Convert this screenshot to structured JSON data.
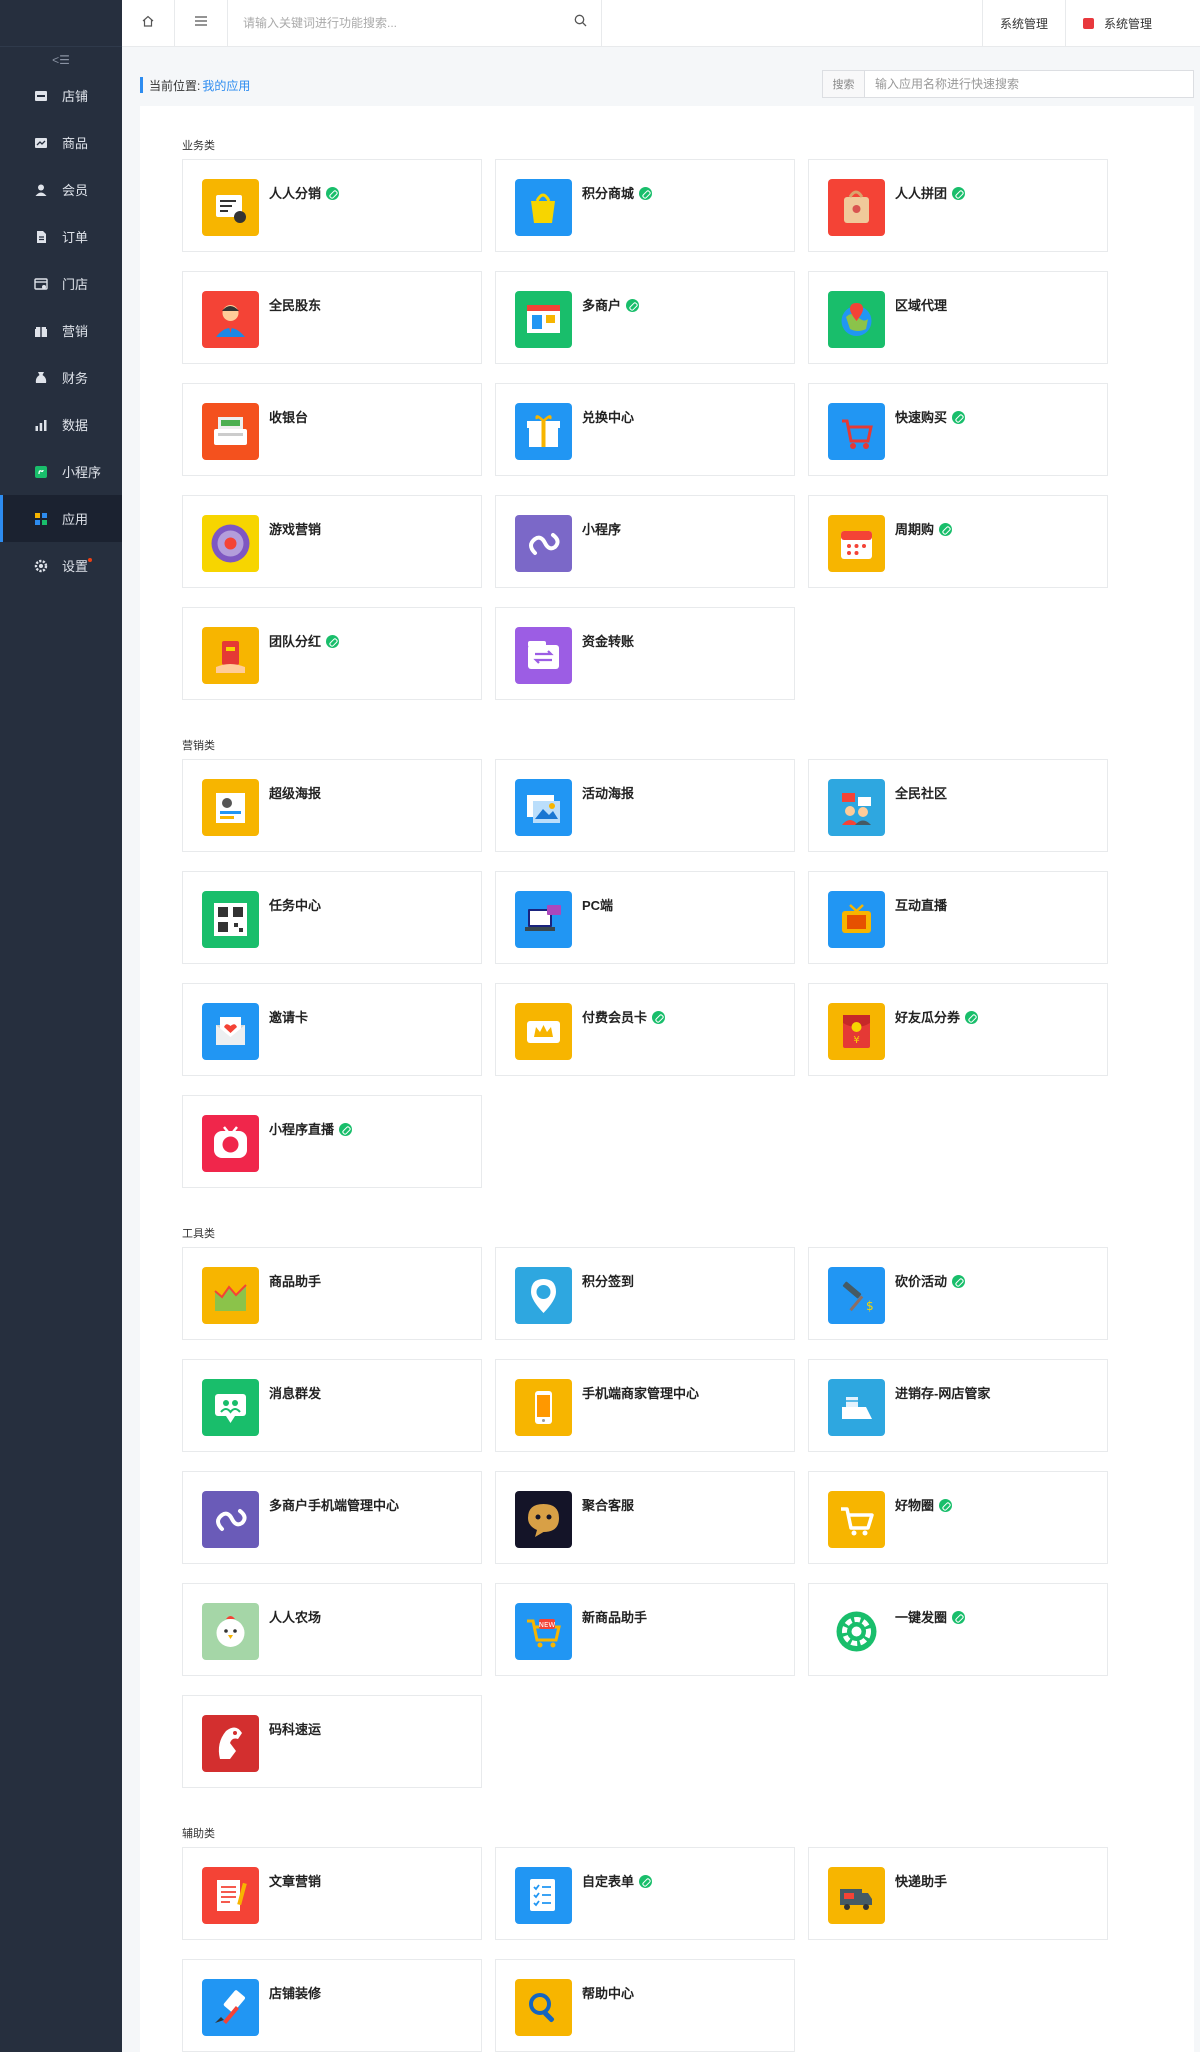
{
  "topbar": {
    "search_placeholder": "请输入关键词进行功能搜索...",
    "menu_1": "系统管理",
    "menu_2": "系统管理"
  },
  "sidebar": {
    "collapse_label": "<☰",
    "items": [
      {
        "label": "店铺",
        "icon": "shop-icon"
      },
      {
        "label": "商品",
        "icon": "goods-icon"
      },
      {
        "label": "会员",
        "icon": "member-icon"
      },
      {
        "label": "订单",
        "icon": "order-icon"
      },
      {
        "label": "门店",
        "icon": "store-icon"
      },
      {
        "label": "营销",
        "icon": "marketing-icon"
      },
      {
        "label": "财务",
        "icon": "finance-icon"
      },
      {
        "label": "数据",
        "icon": "data-icon"
      },
      {
        "label": "小程序",
        "icon": "miniprogram-icon"
      },
      {
        "label": "应用",
        "icon": "apps-icon",
        "active": true
      },
      {
        "label": "设置",
        "icon": "settings-icon"
      }
    ]
  },
  "breadcrumb": {
    "prefix": "当前位置:",
    "current": "我的应用"
  },
  "quick_search": {
    "label": "搜索",
    "placeholder": "输入应用名称进行快速搜索"
  },
  "sections": [
    {
      "title": "业务类",
      "apps": [
        {
          "name": "人人分销",
          "linked": true,
          "color": "#f7b500",
          "icon": "distribution-icon"
        },
        {
          "name": "积分商城",
          "linked": true,
          "color": "#2196f3",
          "icon": "points-mall-icon"
        },
        {
          "name": "人人拼团",
          "linked": true,
          "color": "#f44336",
          "icon": "group-buy-icon"
        },
        {
          "name": "全民股东",
          "linked": false,
          "color": "#f44336",
          "icon": "shareholder-icon"
        },
        {
          "name": "多商户",
          "linked": true,
          "color": "#19be6b",
          "icon": "merchant-icon"
        },
        {
          "name": "区域代理",
          "linked": false,
          "color": "#19be6b",
          "icon": "region-agent-icon"
        },
        {
          "name": "收银台",
          "linked": false,
          "color": "#f4511e",
          "icon": "cashier-icon"
        },
        {
          "name": "兑换中心",
          "linked": false,
          "color": "#2196f3",
          "icon": "exchange-icon"
        },
        {
          "name": "快速购买",
          "linked": true,
          "color": "#2196f3",
          "icon": "quick-buy-icon"
        },
        {
          "name": "游戏营销",
          "linked": false,
          "color": "#f7d500",
          "icon": "game-icon"
        },
        {
          "name": "小程序",
          "linked": false,
          "color": "#7b68c8",
          "icon": "miniprogram-app-icon"
        },
        {
          "name": "周期购",
          "linked": true,
          "color": "#f7b500",
          "icon": "calendar-icon"
        },
        {
          "name": "团队分红",
          "linked": true,
          "color": "#f7b500",
          "icon": "team-bonus-icon"
        },
        {
          "name": "资金转账",
          "linked": false,
          "color": "#9c5de4",
          "icon": "transfer-icon"
        }
      ]
    },
    {
      "title": "营销类",
      "apps": [
        {
          "name": "超级海报",
          "linked": false,
          "color": "#f7b500",
          "icon": "poster-icon"
        },
        {
          "name": "活动海报",
          "linked": false,
          "color": "#2196f3",
          "icon": "event-poster-icon"
        },
        {
          "name": "全民社区",
          "linked": false,
          "color": "#2ea7e0",
          "icon": "community-icon"
        },
        {
          "name": "任务中心",
          "linked": false,
          "color": "#19be6b",
          "icon": "task-icon"
        },
        {
          "name": "PC端",
          "linked": false,
          "color": "#2196f3",
          "icon": "pc-icon"
        },
        {
          "name": "互动直播",
          "linked": false,
          "color": "#2196f3",
          "icon": "live-icon"
        },
        {
          "name": "邀请卡",
          "linked": false,
          "color": "#2196f3",
          "icon": "invite-icon"
        },
        {
          "name": "付费会员卡",
          "linked": true,
          "color": "#f7b500",
          "icon": "vip-card-icon"
        },
        {
          "name": "好友瓜分券",
          "linked": true,
          "color": "#f7b500",
          "icon": "red-packet-icon"
        },
        {
          "name": "小程序直播",
          "linked": true,
          "color": "#f0264b",
          "icon": "mini-live-icon"
        }
      ]
    },
    {
      "title": "工具类",
      "apps": [
        {
          "name": "商品助手",
          "linked": false,
          "color": "#f7b500",
          "icon": "goods-helper-icon"
        },
        {
          "name": "积分签到",
          "linked": false,
          "color": "#2ea7e0",
          "icon": "checkin-icon"
        },
        {
          "name": "砍价活动",
          "linked": true,
          "color": "#2196f3",
          "icon": "bargain-icon"
        },
        {
          "name": "消息群发",
          "linked": false,
          "color": "#19be6b",
          "icon": "message-icon"
        },
        {
          "name": "手机端商家管理中心",
          "linked": false,
          "color": "#f7b500",
          "icon": "mobile-icon"
        },
        {
          "name": "进销存-网店管家",
          "linked": false,
          "color": "#2ea7e0",
          "icon": "inventory-icon"
        },
        {
          "name": "多商户手机端管理中心",
          "linked": false,
          "color": "#6a5bb8",
          "icon": "merchant-mobile-icon"
        },
        {
          "name": "聚合客服",
          "linked": false,
          "color": "#141428",
          "icon": "service-icon"
        },
        {
          "name": "好物圈",
          "linked": true,
          "color": "#f7b500",
          "icon": "cart-icon"
        },
        {
          "name": "人人农场",
          "linked": false,
          "color": "#a5d6a7",
          "icon": "farm-icon"
        },
        {
          "name": "新商品助手",
          "linked": false,
          "color": "#2196f3",
          "icon": "new-goods-icon"
        },
        {
          "name": "一键发圈",
          "linked": true,
          "color": "#ffffff",
          "icon": "moments-icon"
        },
        {
          "name": "码科速运",
          "linked": false,
          "color": "#d32f2f",
          "icon": "delivery-icon"
        }
      ]
    },
    {
      "title": "辅助类",
      "apps": [
        {
          "name": "文章营销",
          "linked": false,
          "color": "#f44336",
          "icon": "article-icon"
        },
        {
          "name": "自定表单",
          "linked": true,
          "color": "#2196f3",
          "icon": "form-icon"
        },
        {
          "name": "快递助手",
          "linked": false,
          "color": "#f7b500",
          "icon": "express-icon"
        },
        {
          "name": "店铺装修",
          "linked": false,
          "color": "#2196f3",
          "icon": "decorate-icon"
        },
        {
          "name": "帮助中心",
          "linked": false,
          "color": "#f7b500",
          "icon": "help-icon"
        }
      ]
    }
  ]
}
